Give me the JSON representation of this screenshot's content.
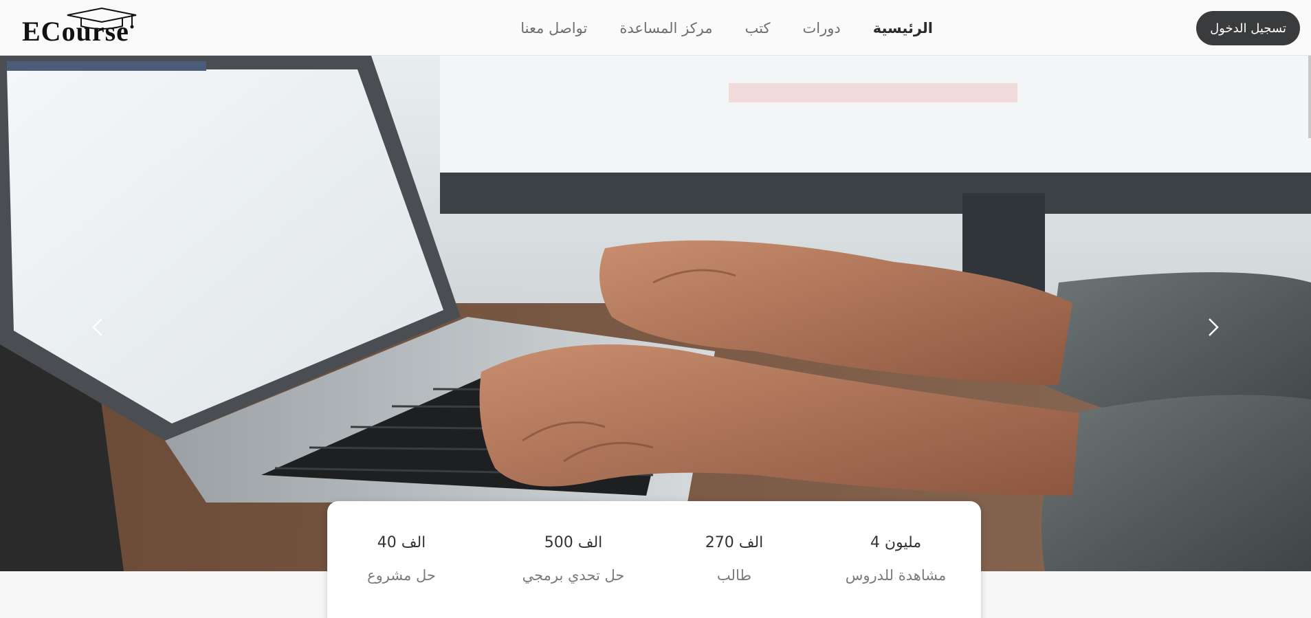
{
  "brand": {
    "logo_text": "ECourse"
  },
  "nav": {
    "items": [
      {
        "label": "الرئيسية",
        "active": true
      },
      {
        "label": "دورات",
        "active": false
      },
      {
        "label": "كتب",
        "active": false
      },
      {
        "label": "مركز المساعدة",
        "active": false
      },
      {
        "label": "تواصل معنا",
        "active": false
      }
    ]
  },
  "header": {
    "login_label": "تسجيل الدخول"
  },
  "carousel": {
    "prev_icon": "chevron-left-icon",
    "next_icon": "chevron-right-icon"
  },
  "stats": [
    {
      "value": "4 مليون",
      "label": "مشاهدة للدروس"
    },
    {
      "value": "270 الف",
      "label": "طالب"
    },
    {
      "value": "500 الف",
      "label": "حل تحدي برمجي"
    },
    {
      "value": "40 الف",
      "label": "حل مشروع"
    }
  ],
  "colors": {
    "login_bg": "#3a3b3d",
    "header_bg": "#fafafa",
    "active_nav": "#2b2b2b",
    "nav_text": "#6e6e6e"
  }
}
